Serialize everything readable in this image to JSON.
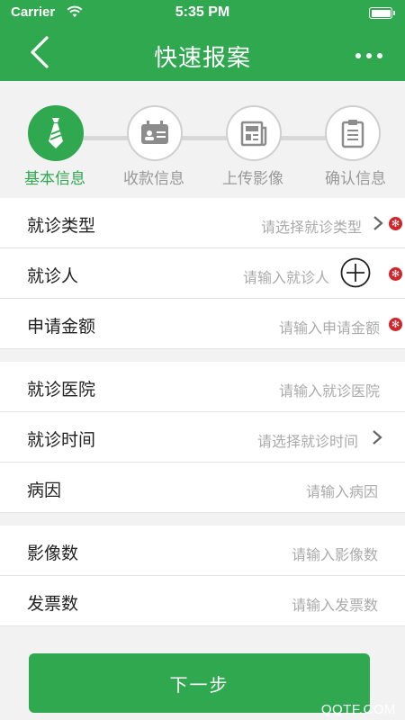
{
  "status_bar": {
    "carrier": "Carrier",
    "time": "5:35 PM"
  },
  "header": {
    "title": "快速报案"
  },
  "steps": [
    {
      "label": "基本信息",
      "icon": "necktie-icon",
      "active": true
    },
    {
      "label": "收款信息",
      "icon": "id-card-icon",
      "active": false
    },
    {
      "label": "上传影像",
      "icon": "newspaper-icon",
      "active": false
    },
    {
      "label": "确认信息",
      "icon": "clipboard-icon",
      "active": false
    }
  ],
  "form": {
    "visit_type": {
      "label": "就诊类型",
      "placeholder": "请选择就诊类型"
    },
    "patient": {
      "label": "就诊人",
      "placeholder": "请输入就诊人"
    },
    "amount": {
      "label": "申请金额",
      "placeholder": "请输入申请金额"
    },
    "hospital": {
      "label": "就诊医院",
      "placeholder": "请输入就诊医院"
    },
    "visit_time": {
      "label": "就诊时间",
      "placeholder": "请选择就诊时间"
    },
    "cause": {
      "label": "病因",
      "placeholder": "请输入病因"
    },
    "image_count": {
      "label": "影像数",
      "placeholder": "请输入影像数"
    },
    "invoice_count": {
      "label": "发票数",
      "placeholder": "请输入发票数"
    }
  },
  "required_mark": "✻",
  "next_button": "下一步",
  "watermark": "QQTF.COM",
  "colors": {
    "brand": "#2fa84f",
    "required": "#d0262b",
    "placeholder": "#aaaaaa"
  }
}
